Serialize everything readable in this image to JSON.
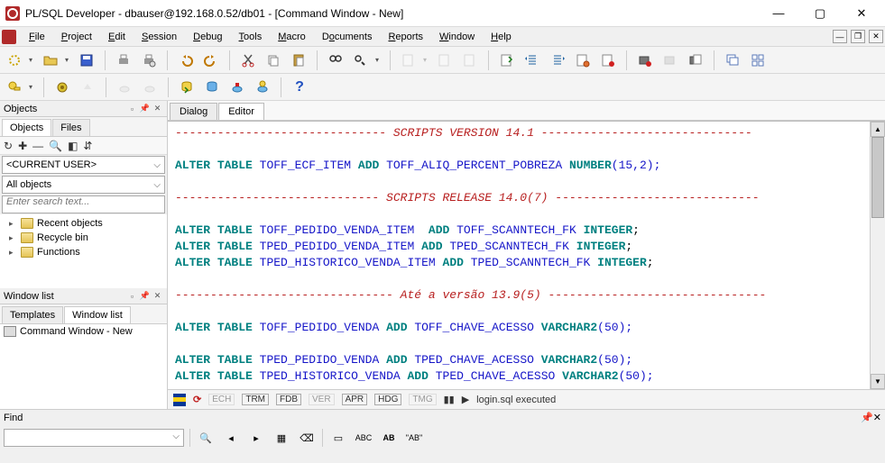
{
  "titlebar": {
    "text": "PL/SQL Developer - dbauser@192.168.0.52/db01 - [Command Window - New]"
  },
  "menu": {
    "file": "File",
    "project": "Project",
    "edit": "Edit",
    "session": "Session",
    "debug": "Debug",
    "tools": "Tools",
    "macro": "Macro",
    "documents": "Documents",
    "reports": "Reports",
    "window": "Window",
    "help": "Help"
  },
  "objects": {
    "panel_title": "Objects",
    "tab_objects": "Objects",
    "tab_files": "Files",
    "user_combo": "<CURRENT USER>",
    "filter_combo": "All objects",
    "search_placeholder": "Enter search text...",
    "tree": [
      {
        "label": "Recent objects"
      },
      {
        "label": "Recycle bin"
      },
      {
        "label": "Functions"
      }
    ]
  },
  "windowlist": {
    "panel_title": "Window list",
    "tab_templates": "Templates",
    "tab_windowlist": "Window list",
    "items": [
      "Command Window - New"
    ]
  },
  "editor_tabs": {
    "dialog": "Dialog",
    "editor": "Editor"
  },
  "code": {
    "l1": {
      "dash": "------------------------------ ",
      "txt": "SCRIPTS VERSION 14.1",
      "dash2": " ------------------------------"
    },
    "l2": {
      "a": "ALTER",
      "b": "TABLE",
      "c": "TOFF_ECF_ITEM",
      "d": "ADD",
      "e": "TOFF_ALIQ_PERCENT_POBREZA",
      "f": "NUMBER",
      "g": "(15,2);"
    },
    "l3": {
      "dash": "----------------------------- ",
      "txt": "SCRIPTS RELEASE 14.0(7)",
      "dash2": " -----------------------------"
    },
    "l4": {
      "a": "ALTER",
      "b": "TABLE",
      "c": "TOFF_PEDIDO_VENDA_ITEM ",
      "d": "ADD",
      "e": "TOFF_SCANNTECH_FK",
      "f": "INTEGER",
      "g": ";"
    },
    "l5": {
      "a": "ALTER",
      "b": "TABLE",
      "c": "TPED_PEDIDO_VENDA_ITEM",
      "d": "ADD",
      "e": "TPED_SCANNTECH_FK",
      "f": "INTEGER",
      "g": ";"
    },
    "l6": {
      "a": "ALTER",
      "b": "TABLE",
      "c": "TPED_HISTORICO_VENDA_ITEM",
      "d": "ADD",
      "e": "TPED_SCANNTECH_FK",
      "f": "INTEGER",
      "g": ";"
    },
    "l7": {
      "dash": "------------------------------- ",
      "txt": "Até a versão 13.9(5)",
      "dash2": " -------------------------------"
    },
    "l8": {
      "a": "ALTER",
      "b": "TABLE",
      "c": "TOFF_PEDIDO_VENDA",
      "d": "ADD",
      "e": "TOFF_CHAVE_ACESSO",
      "f": "VARCHAR2",
      "g": "(50);"
    },
    "l9": {
      "a": "ALTER",
      "b": "TABLE",
      "c": "TPED_PEDIDO_VENDA",
      "d": "ADD",
      "e": "TPED_CHAVE_ACESSO",
      "f": "VARCHAR2",
      "g": "(50);"
    },
    "l10": {
      "a": "ALTER",
      "b": "TABLE",
      "c": "TPED_HISTORICO_VENDA",
      "d": "ADD",
      "e": "TPED_CHAVE_ACESSO",
      "f": "VARCHAR2",
      "g": "(50);"
    }
  },
  "status": {
    "pills": [
      "ECH",
      "TRM",
      "FDB",
      "VER",
      "APR",
      "HDG",
      "TMG"
    ],
    "active_pills": [
      "TRM",
      "FDB",
      "APR",
      "HDG"
    ],
    "msg": "login.sql executed"
  },
  "find": {
    "label": "Find",
    "ab_label": "\"AB\""
  },
  "colors": {
    "keyword": "#008080",
    "ident": "#1515c8",
    "comment": "#b82020"
  }
}
